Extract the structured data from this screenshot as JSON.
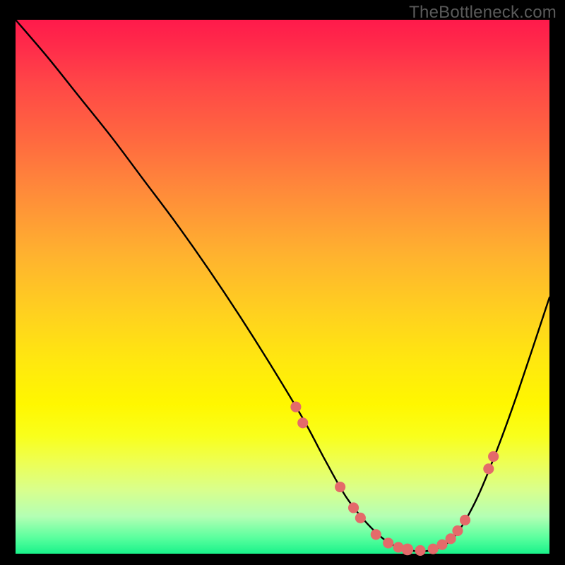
{
  "watermark": "TheBottleneck.com",
  "chart_data": {
    "type": "line",
    "title": "",
    "xlabel": "",
    "ylabel": "",
    "xlim": [
      0,
      100
    ],
    "ylim": [
      0,
      100
    ],
    "series": [
      {
        "name": "bottleneck-curve",
        "x": [
          0,
          6,
          12,
          18,
          24,
          30,
          36,
          42,
          48,
          54,
          58,
          62,
          66,
          70,
          74,
          78,
          82,
          86,
          90,
          94,
          100
        ],
        "y": [
          100,
          93,
          85.5,
          78,
          70,
          62,
          53.5,
          44.5,
          35,
          25,
          17.5,
          10.5,
          5.5,
          2,
          0.6,
          0.7,
          3,
          9.5,
          19,
          30,
          48
        ]
      }
    ],
    "markers": {
      "name": "highlight-dots",
      "color": "#e46a6a",
      "points": [
        {
          "x": 52.5,
          "y": 27.5,
          "r": 1.0
        },
        {
          "x": 53.8,
          "y": 24.5,
          "r": 1.0
        },
        {
          "x": 60.8,
          "y": 12.5,
          "r": 1.0
        },
        {
          "x": 63.3,
          "y": 8.6,
          "r": 1.0
        },
        {
          "x": 64.6,
          "y": 6.7,
          "r": 1.0
        },
        {
          "x": 67.5,
          "y": 3.6,
          "r": 1.0
        },
        {
          "x": 69.8,
          "y": 2.0,
          "r": 1.0
        },
        {
          "x": 71.7,
          "y": 1.2,
          "r": 1.0
        },
        {
          "x": 73.4,
          "y": 0.8,
          "r": 1.1
        },
        {
          "x": 75.8,
          "y": 0.6,
          "r": 1.0
        },
        {
          "x": 78.2,
          "y": 0.9,
          "r": 1.0
        },
        {
          "x": 79.9,
          "y": 1.7,
          "r": 1.0
        },
        {
          "x": 81.5,
          "y": 2.8,
          "r": 1.0
        },
        {
          "x": 82.8,
          "y": 4.3,
          "r": 1.0
        },
        {
          "x": 84.2,
          "y": 6.3,
          "r": 1.0
        },
        {
          "x": 88.6,
          "y": 15.9,
          "r": 1.0
        },
        {
          "x": 89.5,
          "y": 18.2,
          "r": 1.0
        }
      ]
    },
    "background_gradient": {
      "top": "#ff1a4b",
      "mid": "#fff700",
      "bottom": "#19f28a"
    }
  }
}
